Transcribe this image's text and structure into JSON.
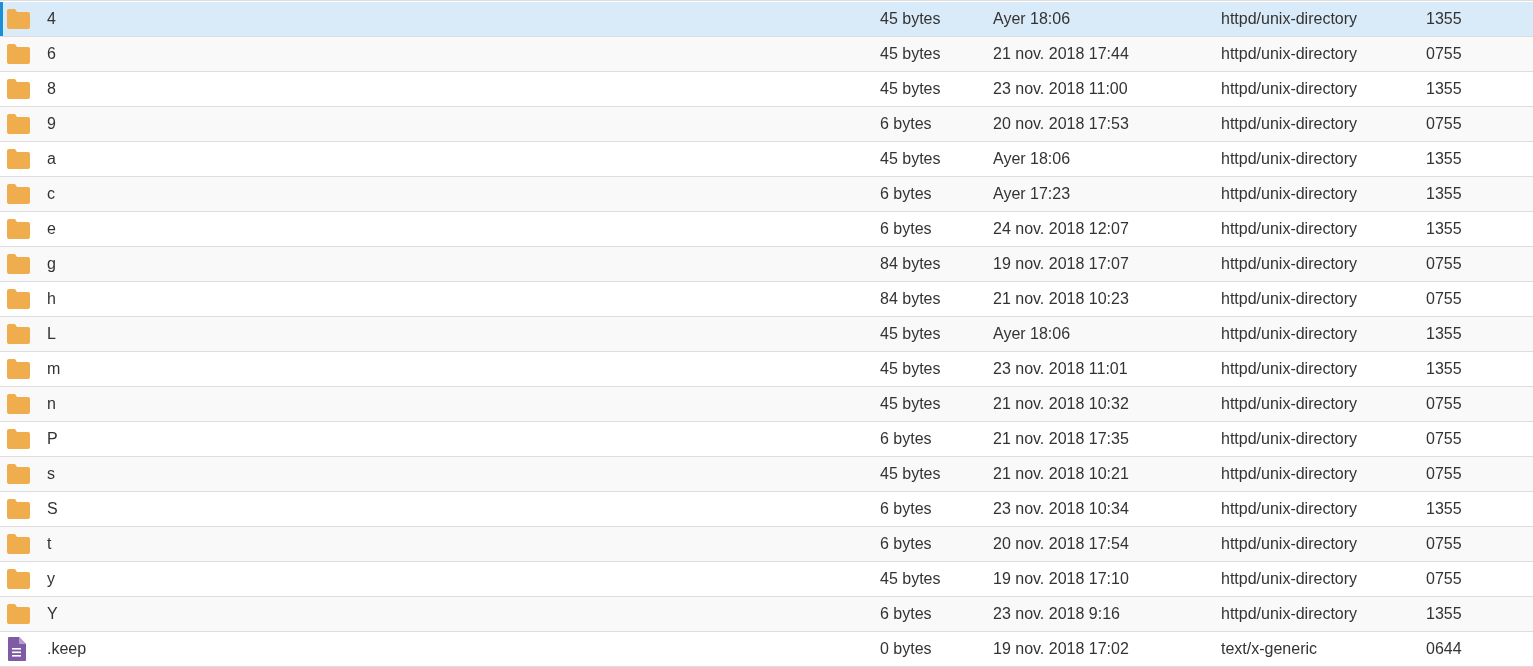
{
  "rows": [
    {
      "kind": "folder",
      "name": "4",
      "size": "45 bytes",
      "modified": "Ayer 18:06",
      "type": "httpd/unix-directory",
      "permissions": "1355",
      "selected": true
    },
    {
      "kind": "folder",
      "name": "6",
      "size": "45 bytes",
      "modified": "21 nov. 2018 17:44",
      "type": "httpd/unix-directory",
      "permissions": "0755",
      "selected": false
    },
    {
      "kind": "folder",
      "name": "8",
      "size": "45 bytes",
      "modified": "23 nov. 2018 11:00",
      "type": "httpd/unix-directory",
      "permissions": "1355",
      "selected": false
    },
    {
      "kind": "folder",
      "name": "9",
      "size": "6 bytes",
      "modified": "20 nov. 2018 17:53",
      "type": "httpd/unix-directory",
      "permissions": "0755",
      "selected": false
    },
    {
      "kind": "folder",
      "name": "a",
      "size": "45 bytes",
      "modified": "Ayer 18:06",
      "type": "httpd/unix-directory",
      "permissions": "1355",
      "selected": false
    },
    {
      "kind": "folder",
      "name": "c",
      "size": "6 bytes",
      "modified": "Ayer 17:23",
      "type": "httpd/unix-directory",
      "permissions": "1355",
      "selected": false
    },
    {
      "kind": "folder",
      "name": "e",
      "size": "6 bytes",
      "modified": "24 nov. 2018 12:07",
      "type": "httpd/unix-directory",
      "permissions": "1355",
      "selected": false
    },
    {
      "kind": "folder",
      "name": "g",
      "size": "84 bytes",
      "modified": "19 nov. 2018 17:07",
      "type": "httpd/unix-directory",
      "permissions": "0755",
      "selected": false
    },
    {
      "kind": "folder",
      "name": "h",
      "size": "84 bytes",
      "modified": "21 nov. 2018 10:23",
      "type": "httpd/unix-directory",
      "permissions": "0755",
      "selected": false
    },
    {
      "kind": "folder",
      "name": "L",
      "size": "45 bytes",
      "modified": "Ayer 18:06",
      "type": "httpd/unix-directory",
      "permissions": "1355",
      "selected": false
    },
    {
      "kind": "folder",
      "name": "m",
      "size": "45 bytes",
      "modified": "23 nov. 2018 11:01",
      "type": "httpd/unix-directory",
      "permissions": "1355",
      "selected": false
    },
    {
      "kind": "folder",
      "name": "n",
      "size": "45 bytes",
      "modified": "21 nov. 2018 10:32",
      "type": "httpd/unix-directory",
      "permissions": "0755",
      "selected": false
    },
    {
      "kind": "folder",
      "name": "P",
      "size": "6 bytes",
      "modified": "21 nov. 2018 17:35",
      "type": "httpd/unix-directory",
      "permissions": "0755",
      "selected": false
    },
    {
      "kind": "folder",
      "name": "s",
      "size": "45 bytes",
      "modified": "21 nov. 2018 10:21",
      "type": "httpd/unix-directory",
      "permissions": "0755",
      "selected": false
    },
    {
      "kind": "folder",
      "name": "S",
      "size": "6 bytes",
      "modified": "23 nov. 2018 10:34",
      "type": "httpd/unix-directory",
      "permissions": "1355",
      "selected": false
    },
    {
      "kind": "folder",
      "name": "t",
      "size": "6 bytes",
      "modified": "20 nov. 2018 17:54",
      "type": "httpd/unix-directory",
      "permissions": "0755",
      "selected": false
    },
    {
      "kind": "folder",
      "name": "y",
      "size": "45 bytes",
      "modified": "19 nov. 2018 17:10",
      "type": "httpd/unix-directory",
      "permissions": "0755",
      "selected": false
    },
    {
      "kind": "folder",
      "name": "Y",
      "size": "6 bytes",
      "modified": "23 nov. 2018 9:16",
      "type": "httpd/unix-directory",
      "permissions": "1355",
      "selected": false
    },
    {
      "kind": "file",
      "name": ".keep",
      "size": "0 bytes",
      "modified": "19 nov. 2018 17:02",
      "type": "text/x-generic",
      "permissions": "0644",
      "selected": false
    }
  ]
}
